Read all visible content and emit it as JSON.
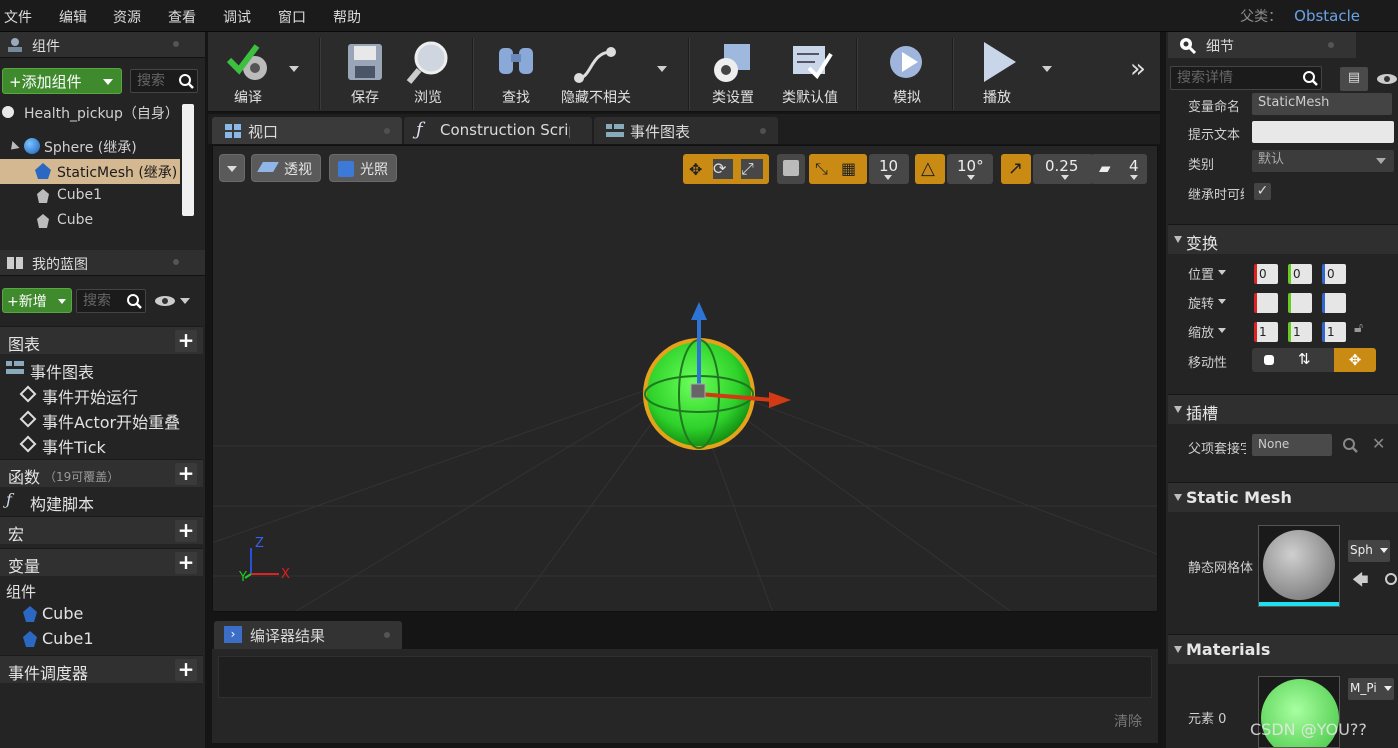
{
  "menu": [
    "文件",
    "编辑",
    "资源",
    "查看",
    "调试",
    "窗口",
    "帮助"
  ],
  "parent_class": {
    "label": "父类：",
    "value": "Obstacle"
  },
  "components_panel": {
    "title": "组件",
    "add_button": "+添加组件",
    "search_placeholder": "搜索",
    "tree": [
      {
        "label": "Health_pickup（自身）"
      },
      {
        "label": "Sphere (继承)"
      },
      {
        "label": "StaticMesh (继承)"
      },
      {
        "label": "Cube1"
      },
      {
        "label": "Cube"
      }
    ]
  },
  "my_blueprint": {
    "title": "我的蓝图",
    "new_button": "+新增",
    "search_placeholder": "搜索",
    "sections": {
      "graphs": "图表",
      "event_graph": "事件图表",
      "events": [
        "事件开始运行",
        "事件Actor开始重叠",
        "事件Tick"
      ],
      "functions": "函数",
      "functions_hint": "（19可覆盖）",
      "construction_script": "构建脚本",
      "macros": "宏",
      "variables": "变量",
      "components_group": "组件",
      "component_vars": [
        "Cube",
        "Cube1"
      ],
      "dispatchers": "事件调度器"
    }
  },
  "toolbar": {
    "compile": "编译",
    "save": "保存",
    "browse": "浏览",
    "find": "查找",
    "hide_unrelated": "隐藏不相关",
    "class_settings": "类设置",
    "class_defaults": "类默认值",
    "simulate": "模拟",
    "play": "播放",
    "more": "»"
  },
  "tabs": [
    {
      "label": "视口"
    },
    {
      "label": "Construction Scrip"
    },
    {
      "label": "事件图表"
    }
  ],
  "viewport": {
    "perspective": "透视",
    "lit": "光照",
    "grid_snap": "10",
    "rotation_snap": "10°",
    "scale_snap": "0.25",
    "camera_speed": "4",
    "axes": {
      "z": "Z",
      "x": "X",
      "y": "Y"
    }
  },
  "compiler": {
    "tab": "编译器结果",
    "clear": "清除"
  },
  "details": {
    "title": "细节",
    "search_placeholder": "搜索详情",
    "variable_name_label": "变量命名",
    "variable_name_value": "StaticMesh",
    "tooltip_label": "提示文本",
    "tooltip_value": "",
    "category_label": "类别",
    "category_value": "默认",
    "inherit_label": "继承时可编",
    "transform_title": "变换",
    "location_label": "位置",
    "rotation_label": "旋转",
    "scale_label": "缩放",
    "mobility_label": "移动性",
    "location_values": [
      "0",
      "0",
      "0"
    ],
    "scale_values": [
      "1",
      "1",
      "1"
    ],
    "sockets_title": "插槽",
    "parent_socket_label": "父项套接字",
    "parent_socket_value": "None",
    "static_mesh_title": "Static Mesh",
    "static_mesh_label": "静态网格体",
    "static_mesh_value": "Sph",
    "materials_title": "Materials",
    "element0_label": "元素 0",
    "element0_value": "M_Pi"
  },
  "watermark": "CSDN @YOU??"
}
